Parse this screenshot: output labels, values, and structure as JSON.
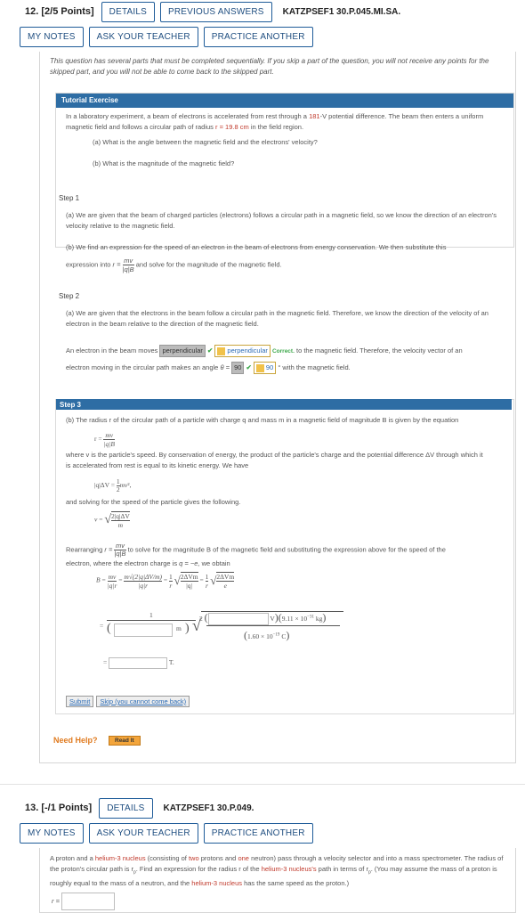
{
  "q12": {
    "number": "12.",
    "points": "[2/5 Points]",
    "details": "DETAILS",
    "previous_answers": "PREVIOUS ANSWERS",
    "reference": "KATZPSEF1 30.P.045.MI.SA.",
    "my_notes": "MY NOTES",
    "ask_teacher": "ASK YOUR TEACHER",
    "practice_another": "PRACTICE ANOTHER",
    "note": "This question has several parts that must be completed sequentially. If you skip a part of the question, you will not receive any points for the skipped part, and you will not be able to come back to the skipped part.",
    "tutorial_label": "Tutorial Exercise",
    "intro_a": "In a laboratory experiment, a beam of electrons is accelerated from rest through a",
    "intro_voltage": "181",
    "intro_b": "-V potential difference. The beam then enters a",
    "intro_c": "uniform magnetic field and follows a circular path of radius",
    "intro_r": "r = 19.8 cm",
    "intro_d": "in the field region.",
    "part_a": "(a) What is the angle between the magnetic field and the electrons' velocity?",
    "part_b": "(b) What is the magnitude of the magnetic field?",
    "step1_label": "Step 1",
    "step1_a": "(a) We are given that the beam of charged particles (electrons) follows a circular path in a magnetic field, so we know the direction of an electron's velocity relative to the magnetic field.",
    "step1_b1": "(b) We find an expression for the speed of an electron in the beam of electrons from energy conservation. We then substitute this",
    "step1_b2_pre": "expression into",
    "step1_b2_post": "and solve for the magnitude of the magnetic field.",
    "step2_label": "Step 2",
    "step2_a": "(a) We are given that the electrons in the beam follow a circular path in the magnetic field. Therefore, we know the direction of the velocity of an electron in the beam relative to the direction of the magnetic field.",
    "step2_s1": "An electron in the beam moves",
    "step2_sel": "perpendicular",
    "step2_ans": "perpendicular",
    "step2_correct": "Correct.",
    "step2_s2": "to the magnetic field. Therefore, the velocity vector of an",
    "step2_s3": "electron moving in the circular path makes an angle",
    "step2_theta": "θ =",
    "step2_val": "90",
    "step2_ans2": "90",
    "step2_s4": "° with the magnetic field.",
    "step3_label": "Step 3",
    "step3_b": "(b) The radius r of the circular path of a particle with charge q and mass m in a magnetic field of magnitude B is given by the equation",
    "step3_c": "where v is the particle's speed. By conservation of energy, the product of the particle's charge and the potential difference ΔV through which it is accelerated from rest is equal to its kinetic energy. We have",
    "step3_d": "and solving for the speed of the particle gives the following.",
    "step3_e1": "Rearranging",
    "step3_e2": "to solve for the magnitude B of the magnetic field and substituting the expression above for the speed of the",
    "step3_e3": "electron, where the electron charge is",
    "step3_e4": "q = −e,",
    "step3_e5": "we obtain",
    "mass_text": "9.11 × 10",
    "mass_exp": "−31",
    "mass_unit": "kg",
    "charge_text": "1.60 × 10",
    "charge_exp": "−19",
    "charge_unit": "C",
    "unit_m": "m",
    "unit_v": "V",
    "unit_t": "T.",
    "submit": "Submit",
    "skip": "Skip (you cannot come back)",
    "need_help": "Need Help?",
    "read_it": "Read It"
  },
  "q13": {
    "number": "13.",
    "points": "[-/1 Points]",
    "details": "DETAILS",
    "reference": "KATZPSEF1 30.P.049.",
    "my_notes": "MY NOTES",
    "ask_teacher": "ASK YOUR TEACHER",
    "practice_another": "PRACTICE ANOTHER",
    "t1": "A proton and a",
    "t_helium": "helium-3 nucleus",
    "t2": "(consisting of",
    "t_two": "two",
    "t3": "protons and",
    "t_one": "one",
    "t4": "neutron) pass through a velocity selector and into a mass spectrometer. The radius of the proton's circular path is r",
    "t5": ". Find an expression for the radius r of the",
    "t_helium2": "helium-3 nucleus's",
    "t6": "path in terms of r",
    "t7": ". (You may assume the mass of a proton is roughly equal to the mass of a neutron, and the",
    "t_helium3": "helium-3 nucleus",
    "t8": "has the same speed as the proton.)",
    "answer_label": "r ="
  }
}
